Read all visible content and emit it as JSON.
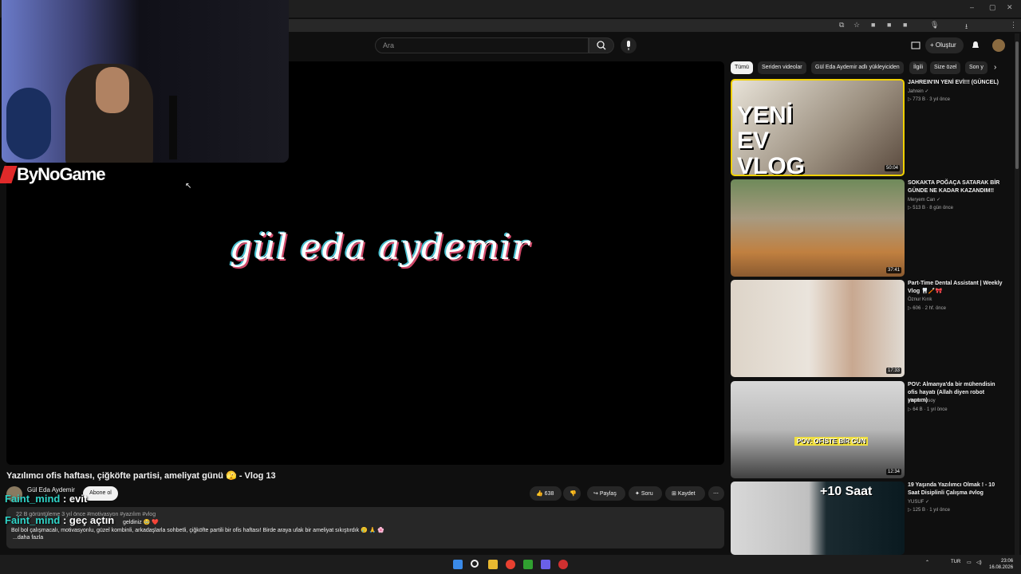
{
  "browser": {
    "minimize": "–",
    "maximize": "▢",
    "close": "✕"
  },
  "header": {
    "search_placeholder": "Ara",
    "create_label": "Oluştur"
  },
  "player": {
    "overlay_brand": "ByNoGame",
    "signature": "gül eda aydemir",
    "cursor": "↖"
  },
  "video": {
    "title": "Yazılımcı ofis haftası, çiğköfte partisi, ameliyat günü 🫣 - Vlog 13",
    "channel": "Gül Eda Aydemir",
    "subscribe": "Abone ol",
    "likes": "638",
    "share": "Paylaş",
    "ask": "Soru",
    "save": "Kaydet",
    "more": "⋯"
  },
  "description": {
    "meta": "22 B görüntüleme  3 yıl önce  #motivasyon #yazılım #vlog",
    "greeting": "geldiniz 🥹 ❤️",
    "body": "Bol bol çalışmacalı, motivasyonlu, güzel kombinli, arkadaşlarla sohbetli, çiğköfte partili bir ofis haftası! Birde araya ufak bir ameliyat sıkıştırdık 🥲 🙏 🌸",
    "more": "...daha fazla"
  },
  "chat": [
    {
      "nick": "Faint_mind",
      "message": " : evit"
    },
    {
      "nick": "Faint_mind",
      "message": " : geç açtın"
    }
  ],
  "chips": [
    "Tümü",
    "Seriden videolar",
    "Gül Eda Aydemir adlı yükleyiciden",
    "İlgili",
    "Size özel",
    "Son y"
  ],
  "recommendations": [
    {
      "title": "JAHREIN'IN YENİ EVİ!!! (GÜNCEL)",
      "channel": "Jahrein ✓",
      "meta": "▷ 773 B · 3 yıl önce",
      "duration": "50:04",
      "thumb_text": "YENİ EV VLOG"
    },
    {
      "title": "SOKAKTA POĞAÇA SATARAK BİR GÜNDE NE KADAR KAZANDIM!!",
      "channel": "Meryem Can ✓",
      "meta": "▷ 513 B · 8 gün önce",
      "duration": "37:41"
    },
    {
      "title": "Part-Time Dental Assistant | Weekly Vlog 🦷🪥🎀",
      "channel": "Öznur Kırık",
      "meta": "▷ 606 · 2 hf. önce",
      "duration": "17:33"
    },
    {
      "title": "POV: Almanya'da bir mühendisin ofis hayatı (Allah diyen robot yaptım)",
      "channel": "Musa Ulusoy",
      "meta": "▷ 64 B · 1 yıl önce",
      "duration": "12:34",
      "thumb_text": "POV: OFİSTE BİR GÜN"
    },
    {
      "title": "19 Yaşında Yazılımcı Olmak ! - 10 Saat Disiplinli Çalışma #vlog",
      "channel": "YUSUF ✓",
      "meta": "▷ 125 B · 1 yıl önce",
      "duration": "",
      "thumb_text": "+10 Saat"
    }
  ],
  "taskbar": {
    "lang": "TUR",
    "time": "23:06",
    "date": "16.08.2026"
  }
}
